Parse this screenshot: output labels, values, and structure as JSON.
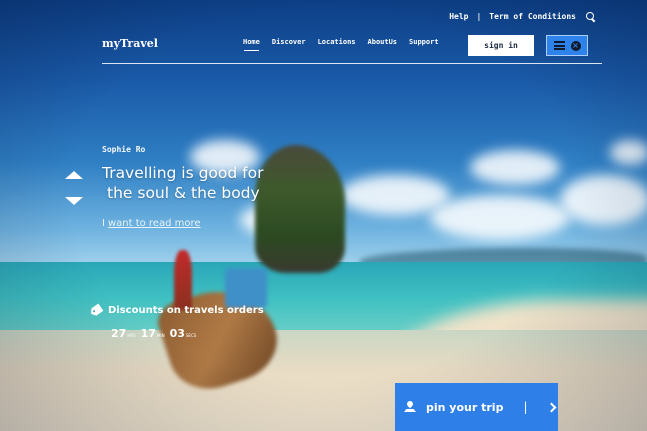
{
  "top_links": {
    "help": "Help",
    "separator": "|",
    "terms": "Term of Conditions"
  },
  "header": {
    "logo": "myTravel",
    "nav": [
      "Home",
      "Discover",
      "Locations",
      "AboutUs",
      "Support"
    ],
    "active_nav": "Home",
    "signin_label": "sign in"
  },
  "hero": {
    "author": "Sophie Ro",
    "title_line1": "Travelling is good for",
    "title_line2": "the soul & the body",
    "read_more_prefix": "I",
    "read_more_link": "want to read more"
  },
  "discount": {
    "label": "Discounts on travels orders",
    "countdown": [
      {
        "value": "27",
        "unit": "HRS"
      },
      {
        "value": "17",
        "unit": "MIN"
      },
      {
        "value": "03",
        "unit": "SECS"
      }
    ]
  },
  "pin": {
    "label": "pin your trip",
    "separator": "|"
  },
  "colors": {
    "accent_blue": "#2f7fe8",
    "menu_blue": "#2d83e9",
    "text": "#ffffff"
  },
  "icons": [
    "search-icon",
    "hamburger-icon",
    "close-icon",
    "arrow-up-icon",
    "arrow-down-icon",
    "tag-icon",
    "pin-icon",
    "chevron-right-icon"
  ]
}
